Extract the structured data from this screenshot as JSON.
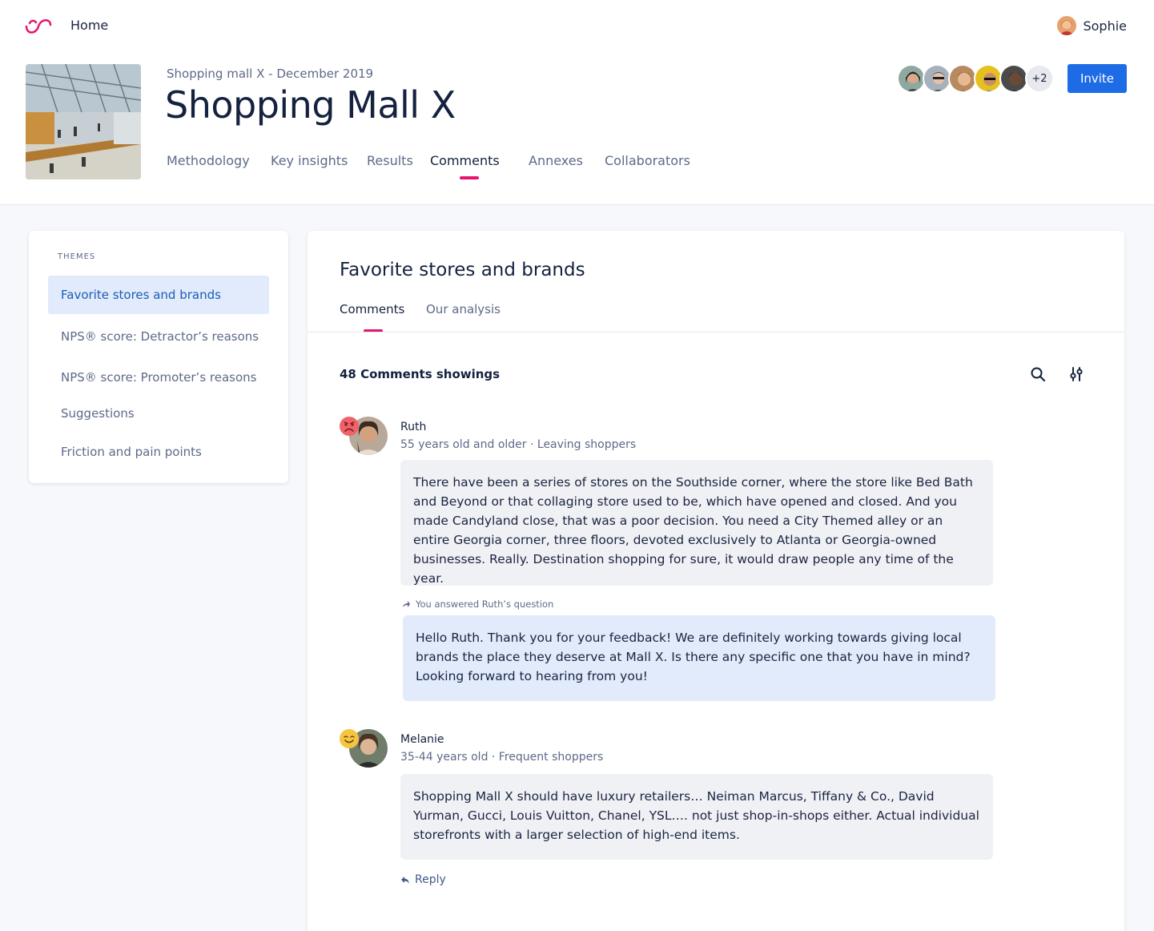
{
  "nav": {
    "home_label": "Home",
    "user_name": "Sophie"
  },
  "project": {
    "subtitle": "Shopping mall X - December 2019",
    "title": "Shopping Mall X",
    "tabs": [
      {
        "label": "Methodology"
      },
      {
        "label": "Key insights"
      },
      {
        "label": "Results"
      },
      {
        "label": "Comments",
        "active": true
      },
      {
        "label": "Annexes"
      },
      {
        "label": "Collaborators"
      }
    ],
    "extra_collaborators": "+2",
    "invite_label": "Invite"
  },
  "sidebar": {
    "heading": "THEMES",
    "items": [
      {
        "label": "Favorite stores and brands",
        "active": true
      },
      {
        "label": "NPS® score: Detractor’s reasons"
      },
      {
        "label": "NPS® score: Promoter’s reasons"
      },
      {
        "label": "Suggestions"
      },
      {
        "label": "Friction and pain points"
      }
    ]
  },
  "main": {
    "title": "Favorite stores and brands",
    "tabs": [
      {
        "label": "Comments",
        "active": true
      },
      {
        "label": "Our analysis"
      }
    ],
    "count_label": "48 Comments showings",
    "comments": [
      {
        "author": "Ruth",
        "meta": "55 years old and older · Leaving shoppers",
        "mood": "sad-face-icon",
        "text": "There have been a series of stores on the Southside corner, where the store like Bed Bath and Beyond or that collaging store used to be, which have opened and closed. And you made Candyland close, that was a poor decision. You need a City Themed alley or an entire Georgia corner, three floors, devoted exclusively to Atlanta or Georgia-owned businesses. Really. Destination shopping for sure, it would draw people any time of the year.",
        "answer_note": "You answered Ruth’s question",
        "answer": "Hello Ruth. Thank you for your feedback! We are definitely working towards giving local brands the place they deserve at Mall X. Is there any specific one that you have in mind? Looking forward to hearing from you!"
      },
      {
        "author": "Melanie",
        "meta": "35-44 years old · Frequent shoppers",
        "mood": "happy-face-icon",
        "text": "Shopping Mall X should have luxury retailers… Neiman Marcus, Tiffany & Co., David Yurman, Gucci, Louis Vuitton, Chanel, YSL…. not just shop-in-shops either. Actual individual storefronts with a larger selection of high-end items.",
        "reply_label": "Reply"
      }
    ]
  },
  "colors": {
    "accent_pink": "#e5166e",
    "primary_blue": "#1e6be6",
    "active_theme_bg": "#e1ebfb",
    "comment_bg": "#f0f1f5",
    "answer_bg": "#e1ebfb"
  }
}
